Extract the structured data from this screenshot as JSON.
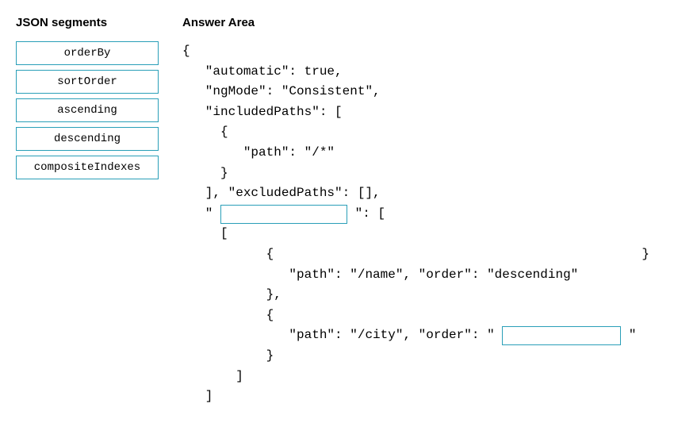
{
  "segments_title": "JSON segments",
  "answer_title": "Answer Area",
  "segments": {
    "item0": "orderBy",
    "item1": "sortOrder",
    "item2": "ascending",
    "item3": "descending",
    "item4": "compositeIndexes"
  },
  "code": {
    "l0": "{",
    "l1": "   \"automatic\": true,",
    "l2": "   \"ngMode\": \"Consistent\",",
    "l3": "   \"includedPaths\": [",
    "l4": "     {",
    "l5": "        \"path\": \"/*\"",
    "l6": "     }",
    "l7": "   ], \"excludedPaths\": [],",
    "l8_pre": "   \" ",
    "l8_post": " \": [",
    "l9": "     [",
    "l10": "           {",
    "l10_trail": "}",
    "l11": "              \"path\": \"/name\", \"order\": \"descending\"",
    "l12": "",
    "l13": "           },",
    "l14": "           {",
    "l15_pre": "              \"path\": \"/city\", \"order\": \" ",
    "l15_post": " \"",
    "l16": "",
    "l17": "           }",
    "l18": "       ]",
    "l19": "   ]"
  }
}
